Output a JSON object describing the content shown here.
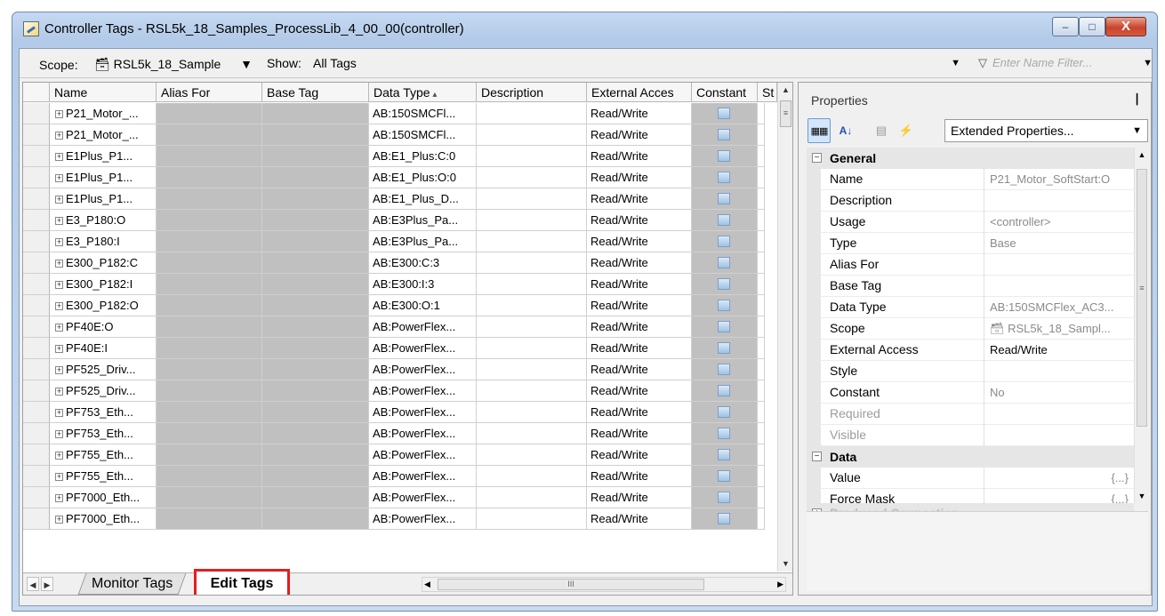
{
  "window": {
    "title": "Controller Tags - RSL5k_18_Samples_ProcessLib_4_00_00(controller)",
    "minimize": "–",
    "maximize": "□",
    "close": "X"
  },
  "filter_bar": {
    "scope_label": "Scope:",
    "scope_value": "RSL5k_18_Sample",
    "show_label": "Show:",
    "show_value": "All Tags",
    "name_filter_placeholder": "Enter Name Filter..."
  },
  "grid": {
    "headers": {
      "name": "Name",
      "alias": "Alias For",
      "base": "Base Tag",
      "type": "Data Type",
      "desc": "Description",
      "ext": "External Acces",
      "constant": "Constant",
      "style": "St"
    },
    "rows": [
      {
        "name": "P21_Motor_...",
        "type": "AB:150SMCFl...",
        "ext": "Read/Write"
      },
      {
        "name": "P21_Motor_...",
        "type": "AB:150SMCFl...",
        "ext": "Read/Write"
      },
      {
        "name": "E1Plus_P1...",
        "type": "AB:E1_Plus:C:0",
        "ext": "Read/Write"
      },
      {
        "name": "E1Plus_P1...",
        "type": "AB:E1_Plus:O:0",
        "ext": "Read/Write"
      },
      {
        "name": "E1Plus_P1...",
        "type": "AB:E1_Plus_D...",
        "ext": "Read/Write"
      },
      {
        "name": "E3_P180:O",
        "type": "AB:E3Plus_Pa...",
        "ext": "Read/Write"
      },
      {
        "name": "E3_P180:I",
        "type": "AB:E3Plus_Pa...",
        "ext": "Read/Write"
      },
      {
        "name": "E300_P182:C",
        "type": "AB:E300:C:3",
        "ext": "Read/Write"
      },
      {
        "name": "E300_P182:I",
        "type": "AB:E300:I:3",
        "ext": "Read/Write"
      },
      {
        "name": "E300_P182:O",
        "type": "AB:E300:O:1",
        "ext": "Read/Write"
      },
      {
        "name": "PF40E:O",
        "type": "AB:PowerFlex...",
        "ext": "Read/Write"
      },
      {
        "name": "PF40E:I",
        "type": "AB:PowerFlex...",
        "ext": "Read/Write"
      },
      {
        "name": "PF525_Driv...",
        "type": "AB:PowerFlex...",
        "ext": "Read/Write"
      },
      {
        "name": "PF525_Driv...",
        "type": "AB:PowerFlex...",
        "ext": "Read/Write"
      },
      {
        "name": "PF753_Eth...",
        "type": "AB:PowerFlex...",
        "ext": "Read/Write"
      },
      {
        "name": "PF753_Eth...",
        "type": "AB:PowerFlex...",
        "ext": "Read/Write"
      },
      {
        "name": "PF755_Eth...",
        "type": "AB:PowerFlex...",
        "ext": "Read/Write"
      },
      {
        "name": "PF755_Eth...",
        "type": "AB:PowerFlex...",
        "ext": "Read/Write"
      },
      {
        "name": "PF7000_Eth...",
        "type": "AB:PowerFlex...",
        "ext": "Read/Write"
      },
      {
        "name": "PF7000_Eth...",
        "type": "AB:PowerFlex...",
        "ext": "Read/Write"
      }
    ]
  },
  "tabs": {
    "monitor": "Monitor Tags",
    "edit": "Edit Tags"
  },
  "properties": {
    "title": "Properties",
    "dropdown": "Extended Properties...",
    "general": {
      "header": "General",
      "name_label": "Name",
      "name_value": "P21_Motor_SoftStart:O",
      "description_label": "Description",
      "usage_label": "Usage",
      "usage_value": "<controller>",
      "type_label": "Type",
      "type_value": "Base",
      "alias_label": "Alias For",
      "base_label": "Base Tag",
      "datatype_label": "Data Type",
      "datatype_value": "AB:150SMCFlex_AC3...",
      "scope_label": "Scope",
      "scope_value": "RSL5k_18_Sampl...",
      "ext_label": "External Access",
      "ext_value": "Read/Write",
      "style_label": "Style",
      "constant_label": "Constant",
      "constant_value": "No",
      "required_label": "Required",
      "visible_label": "Visible"
    },
    "data": {
      "header": "Data",
      "value_label": "Value",
      "value_value": "{...}",
      "force_label": "Force Mask",
      "force_value": "{...}"
    },
    "produced": "Produced Connection"
  },
  "colors": {
    "title_bar": "#b9cfe9",
    "close_button": "#c8452c",
    "readonly_cell": "#c0c0c0",
    "highlight_box": "#e41e1e"
  },
  "icons": [
    "controller-tags-icon",
    "scope-controller-icon",
    "filter-icon",
    "pin-icon",
    "categorized-icon",
    "alphabetical-icon",
    "property-pages-icon",
    "events-icon",
    "expand-icon",
    "collapse-icon"
  ]
}
